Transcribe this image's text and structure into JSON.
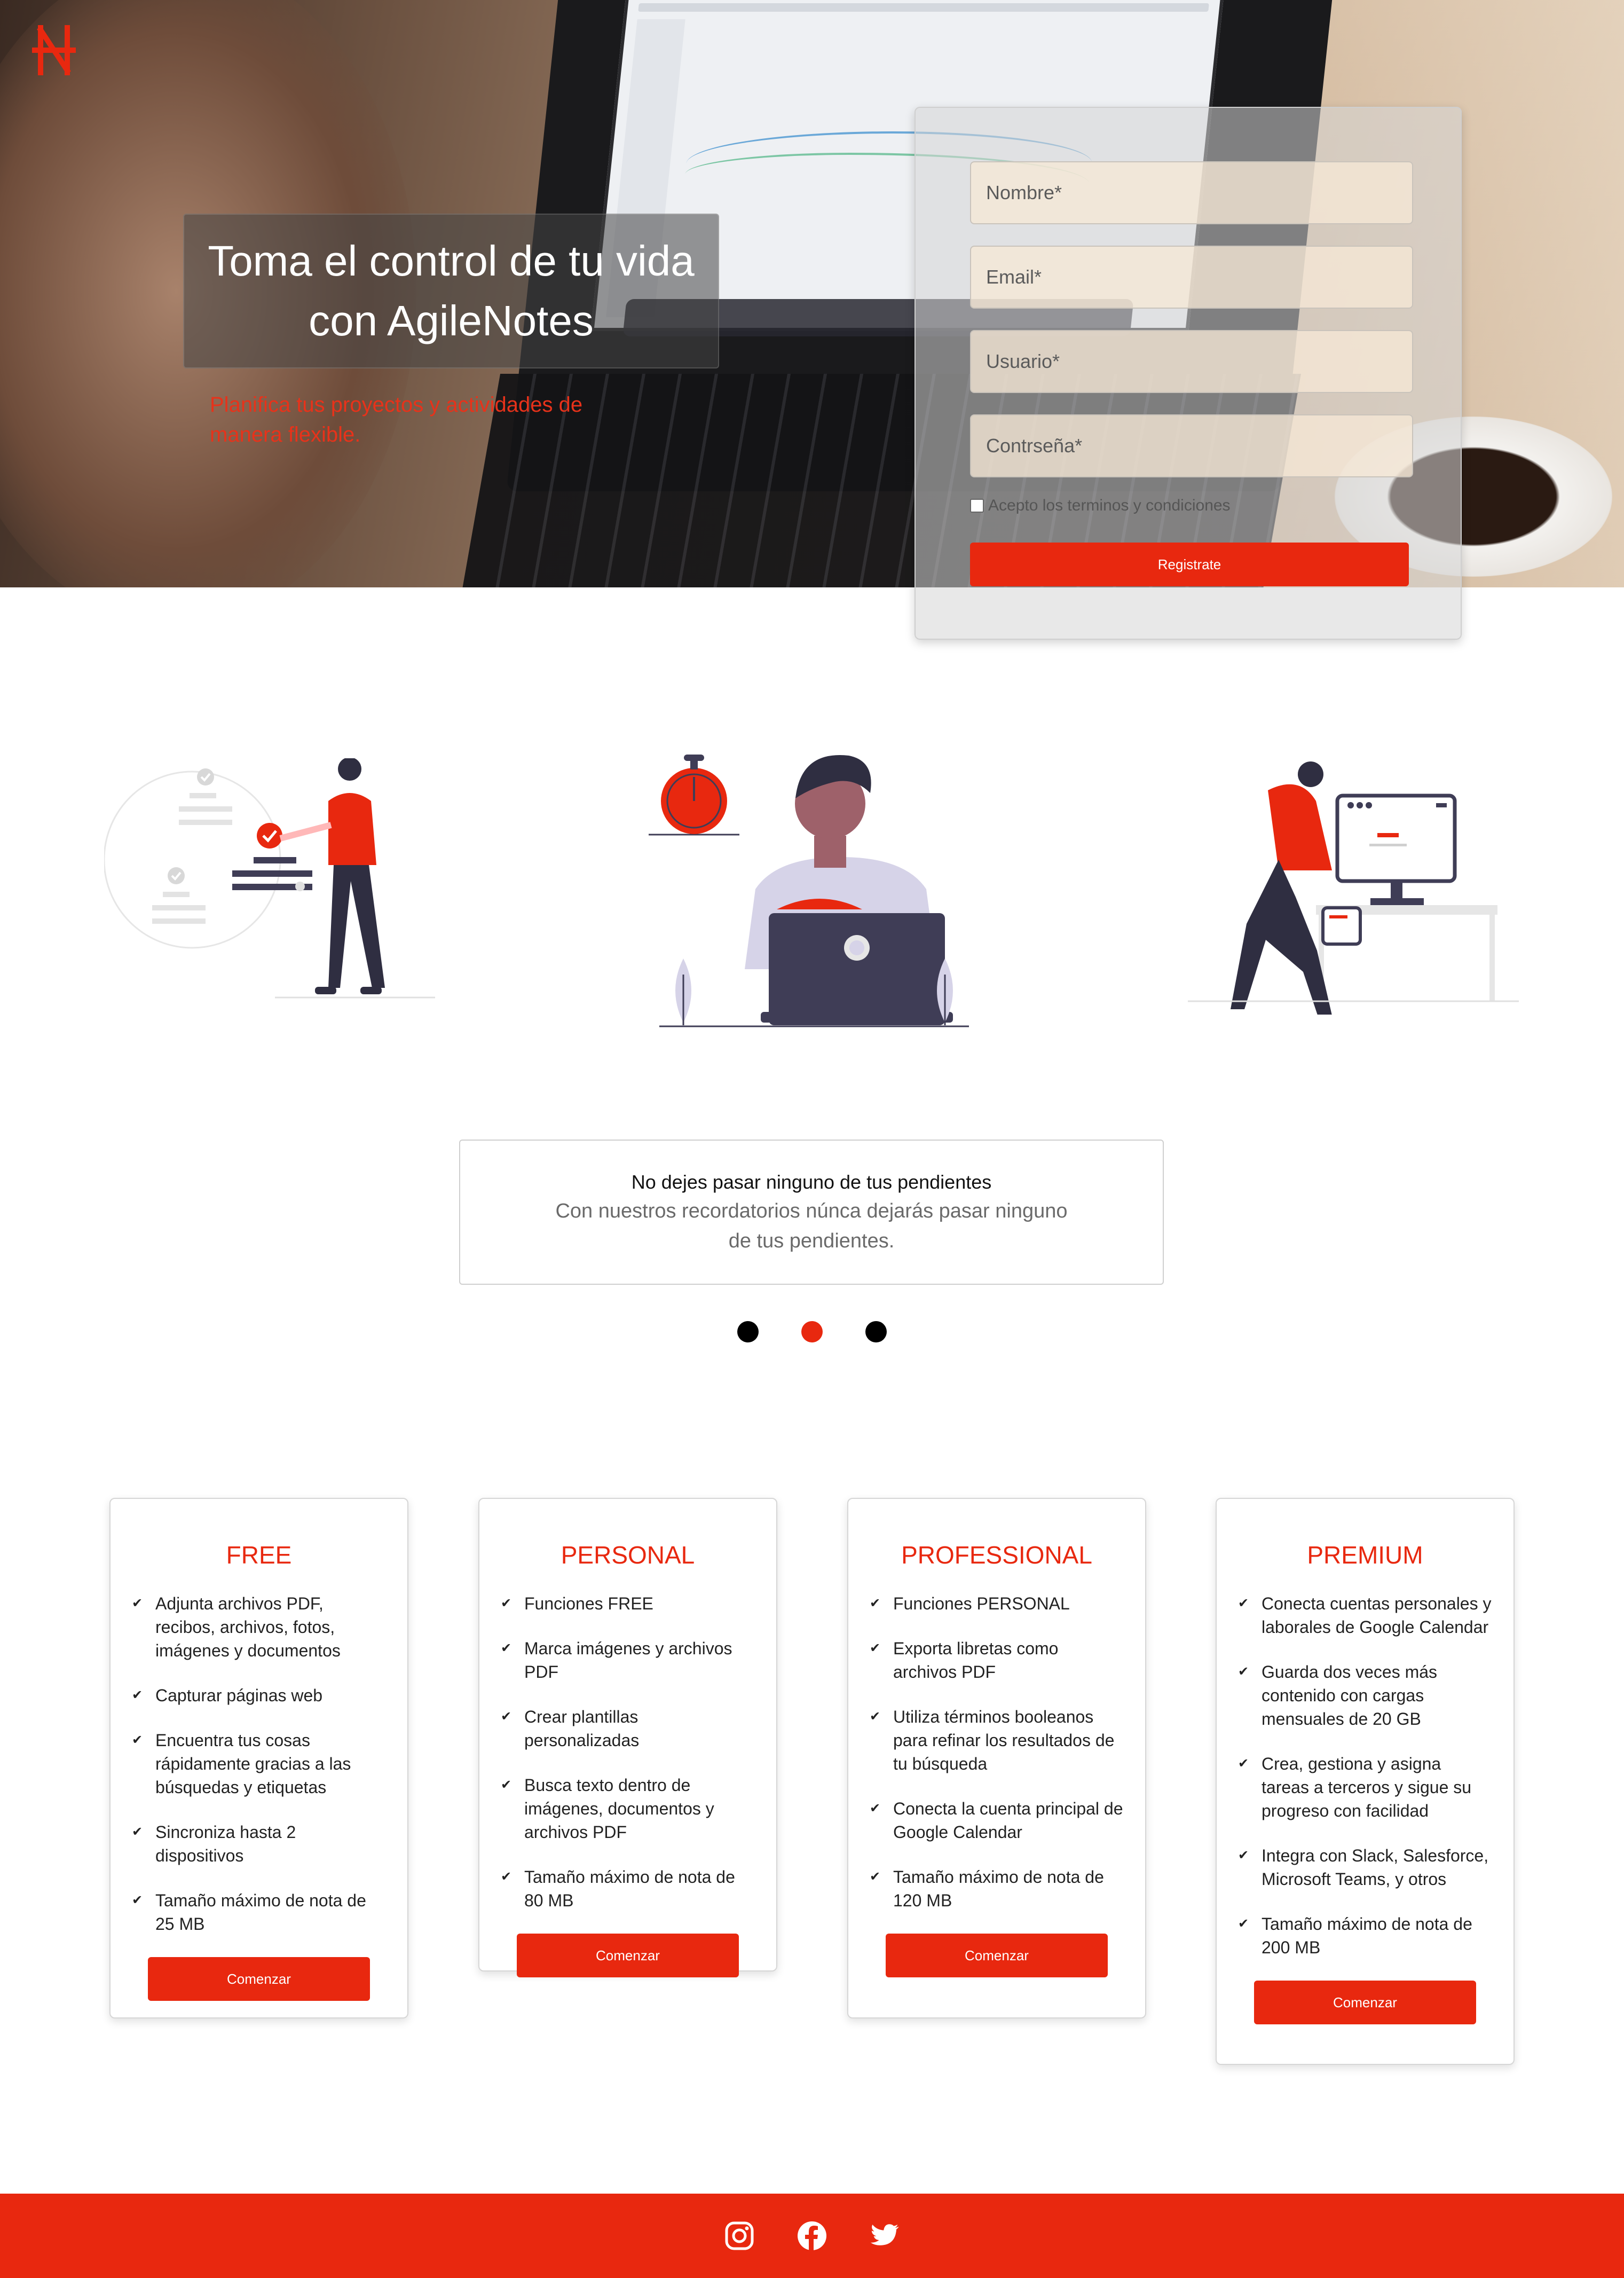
{
  "brand": {
    "accent": "#e8280f"
  },
  "hero": {
    "title": "Toma el control de tu vida con AgileNotes",
    "subtitle": "Planifica tus proyectos y actividades de manera flexible."
  },
  "signup": {
    "name_placeholder": "Nombre*",
    "email_placeholder": "Email*",
    "user_placeholder": "Usuario*",
    "password_placeholder": "Contrseña*",
    "terms_label": "Acepto los terminos y condiciones",
    "submit_label": "Registrate"
  },
  "carousel": {
    "title": "No dejes pasar ninguno de tus pendientes",
    "text": "Con nuestros recordatorios núnca dejarás pasar ninguno de tus pendientes.",
    "active_index": 1,
    "count": 3
  },
  "plans": [
    {
      "name": "FREE",
      "features": [
        "Adjunta archivos PDF, recibos, archivos, fotos, imágenes y documentos",
        "Capturar páginas web",
        "Encuentra tus cosas rápidamente gracias a las búsquedas y etiquetas",
        "Sincroniza hasta 2 dispositivos",
        "Tamaño máximo de nota de 25 MB"
      ],
      "cta": "Comenzar"
    },
    {
      "name": "PERSONAL",
      "features": [
        "Funciones FREE",
        "Marca imágenes y archivos PDF",
        "Crear plantillas personalizadas",
        "Busca texto dentro de imágenes, documentos y archivos PDF",
        "Tamaño máximo de nota de 80 MB"
      ],
      "cta": "Comenzar"
    },
    {
      "name": "PROFESSIONAL",
      "features": [
        "Funciones PERSONAL",
        "Exporta libretas como archivos PDF",
        "Utiliza términos booleanos para refinar los resultados de tu búsqueda",
        "Conecta la cuenta principal de Google Calendar",
        "Tamaño máximo de nota de 120 MB"
      ],
      "cta": "Comenzar"
    },
    {
      "name": "PREMIUM",
      "features": [
        "Conecta cuentas personales y laborales de Google Calendar",
        "Guarda dos veces más contenido con cargas mensuales de 20 GB",
        "Crea, gestiona y asigna tareas a terceros y sigue su progreso con facilidad",
        "Integra con Slack, Salesforce, Microsoft Teams, y otros",
        "Tamaño máximo de nota de 200 MB"
      ],
      "cta": "Comenzar"
    }
  ],
  "footer": {
    "icons": [
      "instagram-icon",
      "facebook-icon",
      "twitter-icon"
    ]
  }
}
